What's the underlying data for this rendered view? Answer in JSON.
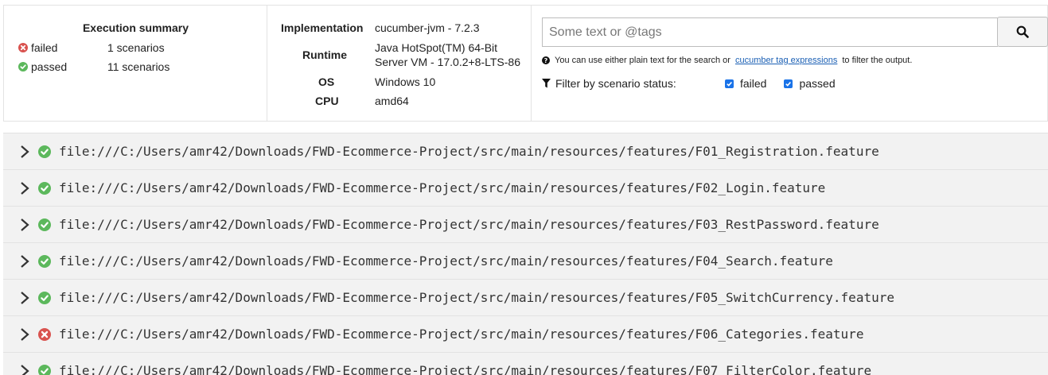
{
  "summary": {
    "title": "Execution summary",
    "rows": [
      {
        "status": "failed",
        "label": "failed",
        "count": "1 scenarios"
      },
      {
        "status": "passed",
        "label": "passed",
        "count": "11 scenarios"
      }
    ]
  },
  "environment": {
    "implementation_key": "Implementation",
    "implementation_val": "cucumber-jvm - 7.2.3",
    "runtime_key": "Runtime",
    "runtime_val_line1": "Java HotSpot(TM) 64-Bit",
    "runtime_val_line2": "Server VM - 17.0.2+8-LTS-86",
    "os_key": "OS",
    "os_val": "Windows 10",
    "cpu_key": "CPU",
    "cpu_val": "amd64"
  },
  "search": {
    "placeholder": "Some text or @tags",
    "help_prefix": "You can use either plain text for the search or",
    "help_link": "cucumber tag expressions",
    "help_suffix": "to filter the output.",
    "filter_label": "Filter by scenario status:",
    "filter_failed": "failed",
    "filter_passed": "passed"
  },
  "colors": {
    "passed": "#5cb85c",
    "failed": "#d9534f",
    "checkbox": "#1a73e8"
  },
  "features": [
    {
      "status": "passed",
      "uri": "file:///C:/Users/amr42/Downloads/FWD-Ecommerce-Project/src/main/resources/features/F01_Registration.feature"
    },
    {
      "status": "passed",
      "uri": "file:///C:/Users/amr42/Downloads/FWD-Ecommerce-Project/src/main/resources/features/F02_Login.feature"
    },
    {
      "status": "passed",
      "uri": "file:///C:/Users/amr42/Downloads/FWD-Ecommerce-Project/src/main/resources/features/F03_RestPassword.feature"
    },
    {
      "status": "passed",
      "uri": "file:///C:/Users/amr42/Downloads/FWD-Ecommerce-Project/src/main/resources/features/F04_Search.feature"
    },
    {
      "status": "passed",
      "uri": "file:///C:/Users/amr42/Downloads/FWD-Ecommerce-Project/src/main/resources/features/F05_SwitchCurrency.feature"
    },
    {
      "status": "failed",
      "uri": "file:///C:/Users/amr42/Downloads/FWD-Ecommerce-Project/src/main/resources/features/F06_Categories.feature"
    },
    {
      "status": "passed",
      "uri": "file:///C:/Users/amr42/Downloads/FWD-Ecommerce-Project/src/main/resources/features/F07_FilterColor.feature"
    }
  ]
}
